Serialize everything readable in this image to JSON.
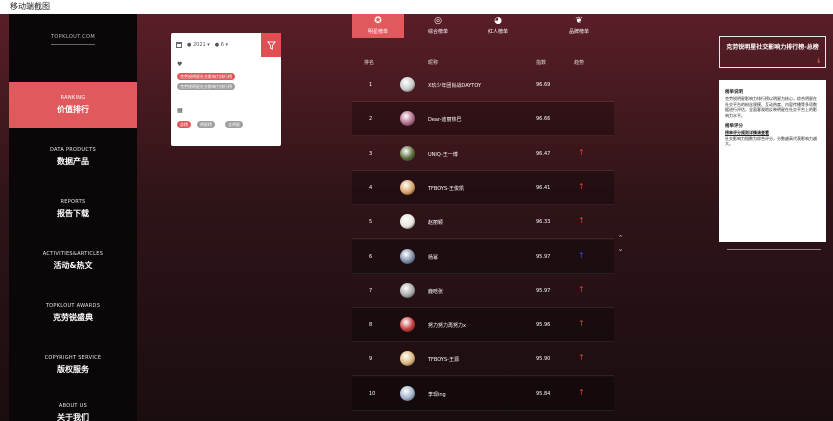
{
  "top_strip": "移动端截图",
  "sidebar": {
    "logo": "TOPKLOUT.COM",
    "items": [
      {
        "en": "RANKING",
        "zh": "价值排行",
        "active": true
      },
      {
        "en": "DATA PRODUCTS",
        "zh": "数据产品",
        "active": false
      },
      {
        "en": "REPORTS",
        "zh": "报告下载",
        "active": false
      },
      {
        "en": "ACTIVITIES&ARTICLES",
        "zh": "活动&热文",
        "active": false
      },
      {
        "en": "TOPKLOUT AWARDS",
        "zh": "克劳锐盛典",
        "active": false
      },
      {
        "en": "COPYRIGHT SERVICE",
        "zh": "版权服务",
        "active": false
      },
      {
        "en": "ABOUT US",
        "zh": "关于我们",
        "active": false
      }
    ]
  },
  "filter": {
    "year": "2021",
    "month": "6",
    "tags_group1": [
      "克劳锐明星社交影响力排行榜",
      "克劳锐明星社交影响力排行榜"
    ],
    "tags_group2": [
      "总榜",
      "明星榜",
      "全明星"
    ]
  },
  "tabs": [
    {
      "label": "明星榜单",
      "icon": "star-icon",
      "active": true
    },
    {
      "label": "综合榜单",
      "icon": "circle-icon",
      "active": false
    },
    {
      "label": "红人榜单",
      "icon": "pie-icon",
      "active": false
    },
    {
      "label": "品牌榜单",
      "icon": "heart-icon",
      "active": false
    }
  ],
  "table": {
    "headers": {
      "rank": "排名",
      "name": "昵称",
      "score": "指数",
      "trend": "趋势"
    },
    "rows": [
      {
        "rank": "1",
        "name": "X玖少年团肖战DAYTOY",
        "score": "96.69",
        "trend": "",
        "avatar": "#c8c8c8"
      },
      {
        "rank": "2",
        "name": "Dear-迪丽热巴",
        "score": "96.66",
        "trend": "",
        "avatar": "#b06a8a"
      },
      {
        "rank": "3",
        "name": "UNIQ-王一博",
        "score": "96.47",
        "trend": "up",
        "avatar": "#5a6b3a"
      },
      {
        "rank": "4",
        "name": "TFBOYS-王俊凯",
        "score": "96.41",
        "trend": "up",
        "avatar": "#d9a066"
      },
      {
        "rank": "5",
        "name": "赵丽颖",
        "score": "96.33",
        "trend": "up",
        "avatar": "#e9e3dc"
      },
      {
        "rank": "6",
        "name": "杨幂",
        "score": "95.97",
        "trend": "down",
        "avatar": "#7c8aa6"
      },
      {
        "rank": "7",
        "name": "鹿晗张",
        "score": "95.97",
        "trend": "up",
        "avatar": "#a8a8a8"
      },
      {
        "rank": "8",
        "name": "努力努力再努力x",
        "score": "95.96",
        "trend": "up",
        "avatar": "#c23b3b"
      },
      {
        "rank": "9",
        "name": "TFBOYS-王源",
        "score": "95.90",
        "trend": "up",
        "avatar": "#d9b37c"
      },
      {
        "rank": "10",
        "name": "李现ing",
        "score": "95.84",
        "trend": "up",
        "avatar": "#9fb0c8"
      }
    ]
  },
  "right_panel": {
    "title": "克劳锐明星社交影响力排行榜-总榜",
    "download": "⤓",
    "sec1_title": "榜单说明",
    "sec1_text": "克劳锐明星影响力排行榜以明星为核心，综合明星在社交平台的粉丝规模、互动热度、内容传播等多项数据进行评估，全面客观地反映明星在社交平台上的影响力水平。",
    "sec2_title": "榜单评分",
    "sec2_link": "榜单评分规则详情请查看",
    "sec2_text": "社交影响力指数为综合评分，分数越高代表影响力越大。"
  },
  "colors": {
    "accent": "#e0595d",
    "up": "#e53935",
    "down": "#2e4fd8"
  }
}
